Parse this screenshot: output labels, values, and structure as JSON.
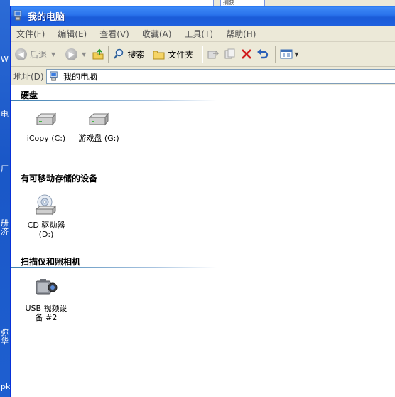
{
  "window": {
    "title": "我的电脑"
  },
  "menu": {
    "items": [
      {
        "label": "文件(F)"
      },
      {
        "label": "编辑(E)"
      },
      {
        "label": "查看(V)"
      },
      {
        "label": "收藏(A)"
      },
      {
        "label": "工具(T)"
      },
      {
        "label": "帮助(H)"
      }
    ]
  },
  "toolbar": {
    "back_label": "后退",
    "search_label": "搜索",
    "folders_label": "文件夹"
  },
  "address": {
    "label": "地址(D)",
    "value": "我的电脑"
  },
  "groups": [
    {
      "title": "硬盘",
      "items": [
        {
          "label": "iCopy (C:)",
          "icon": "hard-drive-icon"
        },
        {
          "label": "游戏盘 (G:)",
          "icon": "hard-drive-icon"
        }
      ]
    },
    {
      "title": "有可移动存储的设备",
      "items": [
        {
          "label": "CD 驱动器\n(D:)",
          "icon": "cd-drive-icon"
        }
      ]
    },
    {
      "title": "扫描仪和照相机",
      "items": [
        {
          "label": "USB 视频设\n备 #2",
          "icon": "camera-icon"
        }
      ]
    }
  ],
  "desktop_glyphs": [
    "W",
    "电",
    "厂",
    "册",
    "济",
    "弥",
    "华",
    "pk"
  ],
  "background_window": {
    "tab_text": "捕获"
  },
  "colors": {
    "titlebar": "#2a73ec",
    "chrome": "#ece9d8"
  }
}
